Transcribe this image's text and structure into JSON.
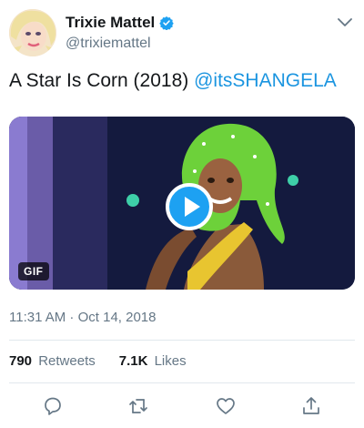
{
  "author": {
    "display_name": "Trixie Mattel",
    "handle": "@trixiemattel",
    "verified": true
  },
  "tweet": {
    "text": "A Star Is Corn (2018)",
    "mention": "@itsSHANGELA"
  },
  "media": {
    "type": "gif",
    "badge_label": "GIF"
  },
  "meta": {
    "timestamp": "11:31 AM · Oct 14, 2018"
  },
  "stats": {
    "retweets_count": "790",
    "retweets_label": "Retweets",
    "likes_count": "7.1K",
    "likes_label": "Likes"
  },
  "icons": {
    "verified": "verified-badge-icon",
    "menu": "chevron-down-icon",
    "play": "play-icon",
    "reply": "reply-icon",
    "retweet": "retweet-icon",
    "like": "heart-icon",
    "share": "share-icon"
  },
  "colors": {
    "link": "#1b95e0",
    "verified": "#1da1f2",
    "secondary_text": "#657786",
    "divider": "#e1e8ed"
  }
}
